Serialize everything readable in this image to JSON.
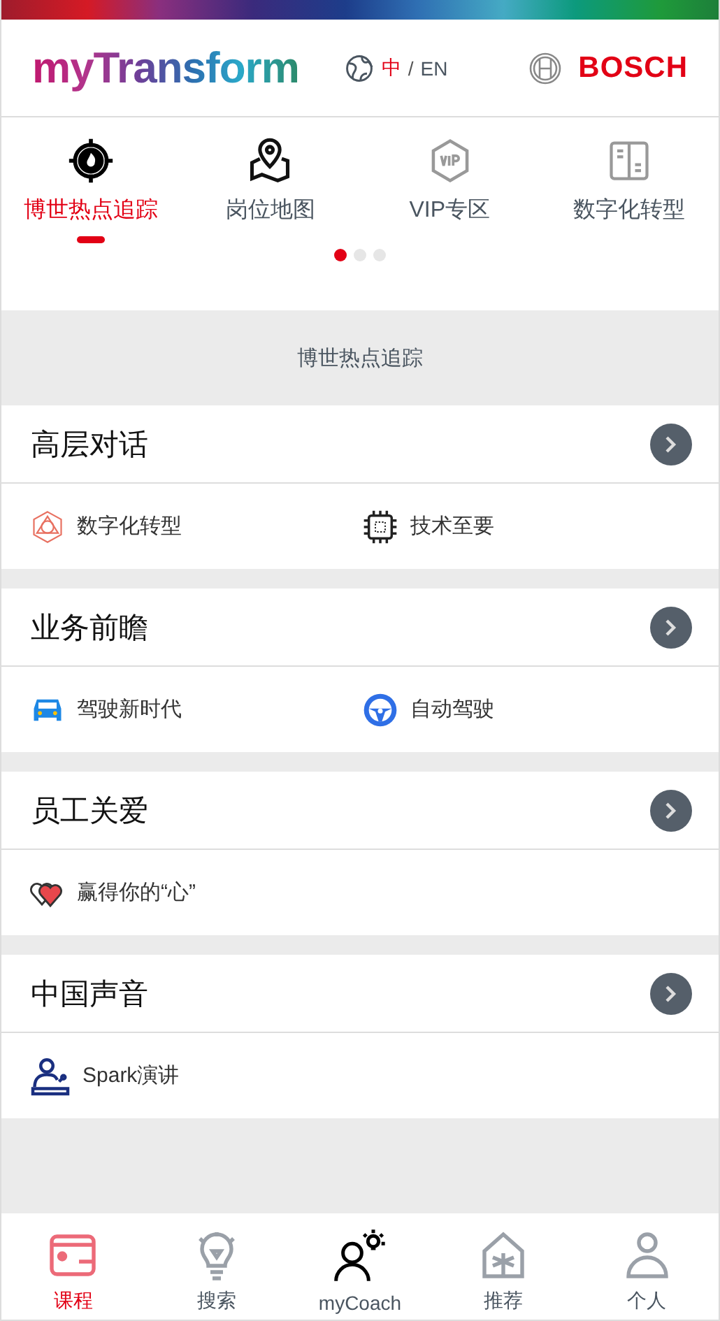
{
  "header": {
    "logo": "myTransform",
    "languages": [
      {
        "label": "中",
        "selected": true
      },
      {
        "label": "EN",
        "selected": false
      }
    ],
    "language_separator": "/",
    "brand": "BOSCH"
  },
  "tabs": [
    {
      "label": "博世热点追踪",
      "kind": "target",
      "selected": true
    },
    {
      "label": "岗位地图",
      "kind": "map",
      "selected": false
    },
    {
      "label": "VIP专区",
      "kind": "vip",
      "selected": false
    },
    {
      "label": "数字化转型",
      "kind": "book",
      "selected": false
    }
  ],
  "pager": [
    {
      "selected": true
    },
    {
      "selected": false
    },
    {
      "selected": false
    }
  ],
  "section_title": "博世热点追踪",
  "sections": [
    {
      "title": "高层对话",
      "items": [
        {
          "label": "数字化转型",
          "kind": "polygon"
        },
        {
          "label": "技术至要",
          "kind": "chip"
        }
      ]
    },
    {
      "title": "业务前瞻",
      "items": [
        {
          "label": "驾驶新时代",
          "kind": "car"
        },
        {
          "label": "自动驾驶",
          "kind": "wheel"
        }
      ]
    },
    {
      "title": "员工关爱",
      "items": [
        {
          "label": "赢得你的“心”",
          "kind": "hearts"
        }
      ]
    },
    {
      "title": "中国声音",
      "items": [
        {
          "label": "Spark演讲",
          "kind": "speaker"
        }
      ]
    }
  ],
  "bottom_nav": [
    {
      "label": "课程",
      "kind": "course",
      "selected": true
    },
    {
      "label": "搜索",
      "kind": "bulb",
      "selected": false
    },
    {
      "label": "myCoach",
      "kind": "coach",
      "selected": false
    },
    {
      "label": "推荐",
      "kind": "house",
      "selected": false
    },
    {
      "label": "个人",
      "kind": "person",
      "selected": false
    }
  ]
}
